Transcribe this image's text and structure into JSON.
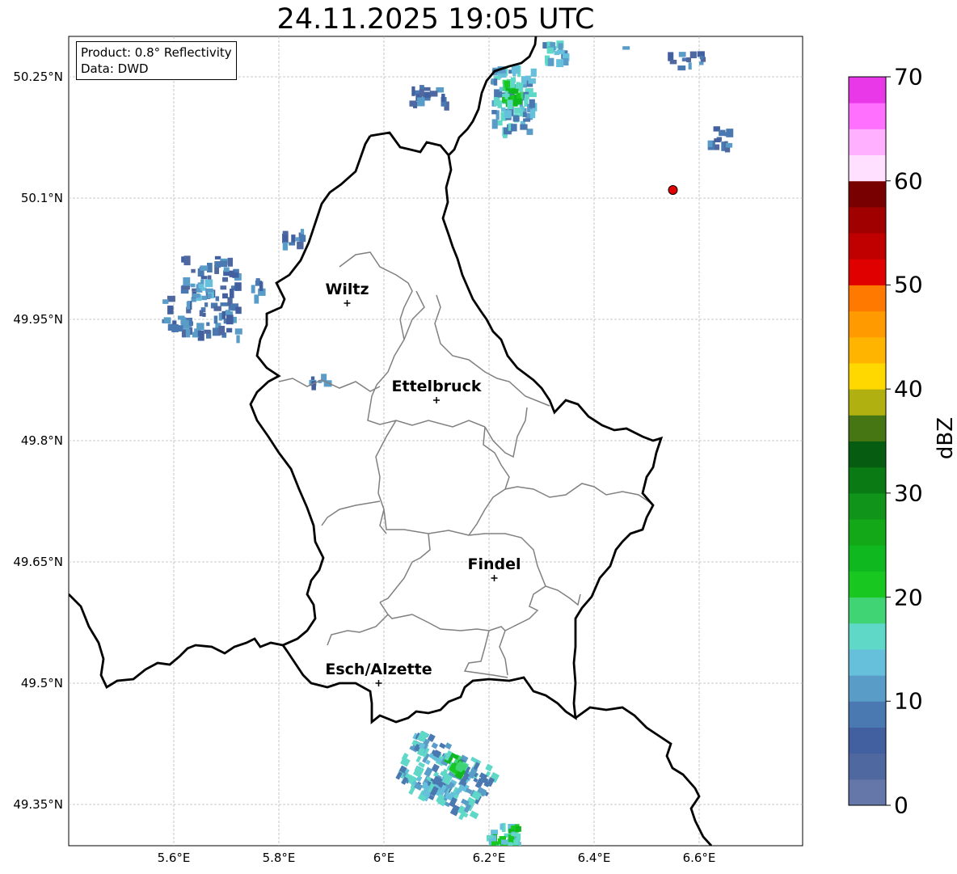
{
  "title": "24.11.2025 19:05 UTC",
  "info": {
    "product": "Product: 0.8° Reflectivity",
    "data": "Data: DWD"
  },
  "chart_data": {
    "type": "map",
    "x_ticks": [
      "5.6°E",
      "5.8°E",
      "6°E",
      "6.2°E",
      "6.4°E",
      "6.6°E"
    ],
    "y_ticks": [
      "50.25°N",
      "50.1°N",
      "49.95°N",
      "49.8°N",
      "49.65°N",
      "49.5°N",
      "49.35°N"
    ],
    "cities": [
      {
        "name": "Wiltz",
        "lon": 5.93,
        "lat": 49.97
      },
      {
        "name": "Ettelbruck",
        "lon": 6.1,
        "lat": 49.85
      },
      {
        "name": "Findel",
        "lon": 6.21,
        "lat": 49.63
      },
      {
        "name": "Esch/Alzette",
        "lon": 5.99,
        "lat": 49.5
      }
    ],
    "marker": {
      "lon": 6.55,
      "lat": 50.11,
      "color": "#e00000"
    },
    "colorbar": {
      "label": "dBZ",
      "ticks": [
        "0",
        "10",
        "20",
        "30",
        "40",
        "50",
        "60",
        "70"
      ],
      "levels": [
        "#6477a8",
        "#5068a0",
        "#4260a0",
        "#4a78b0",
        "#5a9cc8",
        "#66c0dc",
        "#60d8c8",
        "#40d474",
        "#18c820",
        "#10b820",
        "#12a818",
        "#10941a",
        "#0a7a14",
        "#065c10",
        "#467614",
        "#b0b010",
        "#ffd800",
        "#ffb400",
        "#ff9a00",
        "#ff7800",
        "#e00000",
        "#c00000",
        "#a00000",
        "#780000",
        "#ffe0ff",
        "#ffb0ff",
        "#ff70ff",
        "#e838e8"
      ]
    }
  }
}
